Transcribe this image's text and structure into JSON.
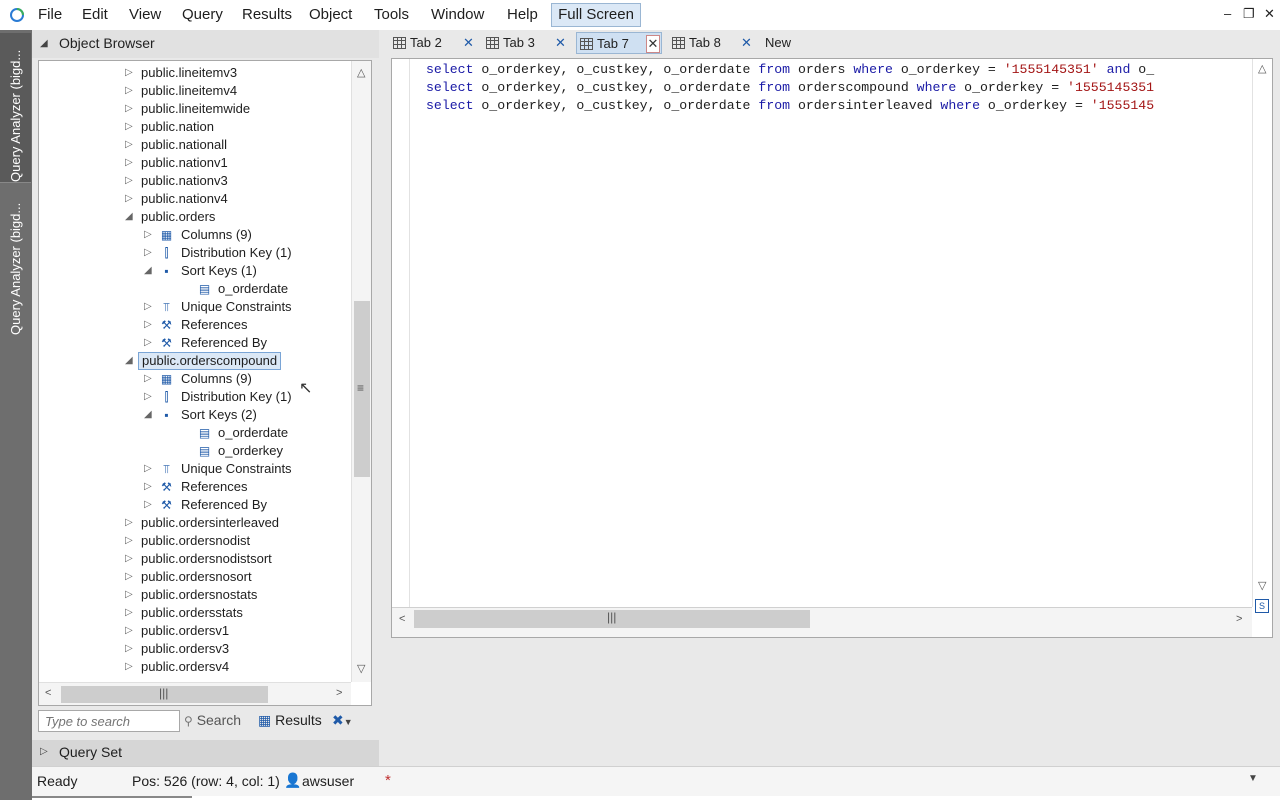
{
  "menu": {
    "items": [
      "File",
      "Edit",
      "View",
      "Query",
      "Results",
      "Object",
      "Tools",
      "Window",
      "Help"
    ],
    "full_screen": "Full Screen"
  },
  "window_controls": {
    "minimize": "–",
    "restore": "❐",
    "close": "✕"
  },
  "left_strip": {
    "tabs": [
      "Query Analyzer (bigd...",
      "Query Analyzer (bigd..."
    ]
  },
  "object_browser": {
    "title": "Object Browser",
    "tree": [
      {
        "label": "public.lineitemv3",
        "level": 0,
        "expanded": false
      },
      {
        "label": "public.lineitemv4",
        "level": 0,
        "expanded": false
      },
      {
        "label": "public.lineitemwide",
        "level": 0,
        "expanded": false
      },
      {
        "label": "public.nation",
        "level": 0,
        "expanded": false
      },
      {
        "label": "public.nationall",
        "level": 0,
        "expanded": false
      },
      {
        "label": "public.nationv1",
        "level": 0,
        "expanded": false
      },
      {
        "label": "public.nationv3",
        "level": 0,
        "expanded": false
      },
      {
        "label": "public.nationv4",
        "level": 0,
        "expanded": false
      },
      {
        "label": "public.orders",
        "level": 0,
        "expanded": true
      },
      {
        "label": "Columns (9)",
        "level": 1,
        "expanded": false,
        "icon": "columns-icon"
      },
      {
        "label": "Distribution Key (1)",
        "level": 1,
        "expanded": false,
        "icon": "distribution-key-icon"
      },
      {
        "label": "Sort Keys (1)",
        "level": 1,
        "expanded": true,
        "icon": "sort-keys-icon"
      },
      {
        "label": "o_orderdate",
        "level": 2,
        "icon": "column-icon"
      },
      {
        "label": "Unique Constraints",
        "level": 1,
        "expanded": false,
        "icon": "unique-constraints-icon"
      },
      {
        "label": "References",
        "level": 1,
        "expanded": false,
        "icon": "key-icon"
      },
      {
        "label": "Referenced By",
        "level": 1,
        "expanded": false,
        "icon": "key-icon"
      },
      {
        "label": "public.orderscompound",
        "level": 0,
        "expanded": true,
        "selected": true
      },
      {
        "label": "Columns (9)",
        "level": 1,
        "expanded": false,
        "icon": "columns-icon"
      },
      {
        "label": "Distribution Key (1)",
        "level": 1,
        "expanded": false,
        "icon": "distribution-key-icon"
      },
      {
        "label": "Sort Keys (2)",
        "level": 1,
        "expanded": true,
        "icon": "sort-keys-icon"
      },
      {
        "label": "o_orderdate",
        "level": 2,
        "icon": "column-icon"
      },
      {
        "label": "o_orderkey",
        "level": 2,
        "icon": "column-icon"
      },
      {
        "label": "Unique Constraints",
        "level": 1,
        "expanded": false,
        "icon": "unique-constraints-icon"
      },
      {
        "label": "References",
        "level": 1,
        "expanded": false,
        "icon": "key-icon"
      },
      {
        "label": "Referenced By",
        "level": 1,
        "expanded": false,
        "icon": "key-icon"
      },
      {
        "label": "public.ordersinterleaved",
        "level": 0,
        "expanded": false
      },
      {
        "label": "public.ordersnodist",
        "level": 0,
        "expanded": false
      },
      {
        "label": "public.ordersnodistsort",
        "level": 0,
        "expanded": false
      },
      {
        "label": "public.ordersnosort",
        "level": 0,
        "expanded": false
      },
      {
        "label": "public.ordersnostats",
        "level": 0,
        "expanded": false
      },
      {
        "label": "public.ordersstats",
        "level": 0,
        "expanded": false
      },
      {
        "label": "public.ordersv1",
        "level": 0,
        "expanded": false
      },
      {
        "label": "public.ordersv3",
        "level": 0,
        "expanded": false
      },
      {
        "label": "public.ordersv4",
        "level": 0,
        "expanded": false
      }
    ],
    "search_placeholder": "Type to search",
    "search_label": "Search",
    "results_label": "Results"
  },
  "query_set": {
    "label": "Query Set"
  },
  "tabs": [
    {
      "label": "Tab 2",
      "active": false
    },
    {
      "label": "Tab 3",
      "active": false
    },
    {
      "label": "Tab 7",
      "active": true
    },
    {
      "label": "Tab 8",
      "active": false
    }
  ],
  "new_tab_label": "New",
  "editor": {
    "lines": [
      [
        [
          "kw",
          "select"
        ],
        [
          "txt",
          " o_orderkey, o_custkey, o_orderdate "
        ],
        [
          "kw",
          "from"
        ],
        [
          "txt",
          " orders "
        ],
        [
          "kw",
          "where"
        ],
        [
          "txt",
          " o_orderkey = "
        ],
        [
          "str",
          "'1555145351'"
        ],
        [
          "txt",
          " "
        ],
        [
          "kw",
          "and"
        ],
        [
          "txt",
          " o_"
        ]
      ],
      [
        [
          "kw",
          "select"
        ],
        [
          "txt",
          " o_orderkey, o_custkey, o_orderdate "
        ],
        [
          "kw",
          "from"
        ],
        [
          "txt",
          " orderscompound "
        ],
        [
          "kw",
          "where"
        ],
        [
          "txt",
          " o_orderkey = "
        ],
        [
          "str",
          "'1555145351"
        ]
      ],
      [
        [
          "kw",
          "select"
        ],
        [
          "txt",
          " o_orderkey, o_custkey, o_orderdate "
        ],
        [
          "kw",
          "from"
        ],
        [
          "txt",
          " ordersinterleaved "
        ],
        [
          "kw",
          "where"
        ],
        [
          "txt",
          " o_orderkey = "
        ],
        [
          "str",
          "'1555145"
        ]
      ]
    ]
  },
  "status": {
    "ready": "Ready",
    "position": "Pos: 526 (row: 4, col: 1)",
    "user": "awsuser",
    "dirty_marker": "*"
  },
  "colors": {
    "keyword": "#1a1aa6",
    "string": "#a31515",
    "accent": "#1f5aa8",
    "selection": "#dbe8f6"
  }
}
